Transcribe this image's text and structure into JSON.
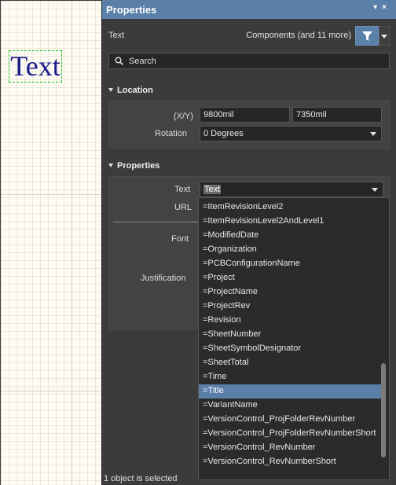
{
  "canvas": {
    "text_object": "Text"
  },
  "panel": {
    "title": "Properties",
    "title_icons": "▾ ×",
    "object_type": "Text",
    "filter_scope": "Components (and 11 more)",
    "search_placeholder": "Search",
    "location": {
      "header": "Location",
      "xy_label": "(X/Y)",
      "x_value": "9800mil",
      "y_value": "7350mil",
      "rotation_label": "Rotation",
      "rotation_value": "0 Degrees"
    },
    "properties": {
      "header": "Properties",
      "text_label": "Text",
      "text_value": "Text",
      "url_label": "URL",
      "font_label": "Font",
      "justification_label": "Justification"
    },
    "status": "1 object is selected"
  },
  "dropdown": {
    "items": [
      "=ItemRevisionLevel2",
      "=ItemRevisionLevel2AndLevel1",
      "=ModifiedDate",
      "=Organization",
      "=PCBConfigurationName",
      "=Project",
      "=ProjectName",
      "=ProjectRev",
      "=Revision",
      "=SheetNumber",
      "=SheetSymbolDesignator",
      "=SheetTotal",
      "=Time",
      "=Title",
      "=VariantName",
      "=VersionControl_ProjFolderRevNumber",
      "=VersionControl_ProjFolderRevNumberShort",
      "=VersionControl_RevNumber",
      "=VersionControl_RevNumberShort"
    ],
    "selected_index": 13
  },
  "colors": {
    "accent": "#5a7fa8",
    "panel_bg": "#3b3b3b",
    "canvas_bg": "#fdfbf3",
    "text_object_color": "#1a1a8a",
    "selection_outline": "#20c020"
  }
}
